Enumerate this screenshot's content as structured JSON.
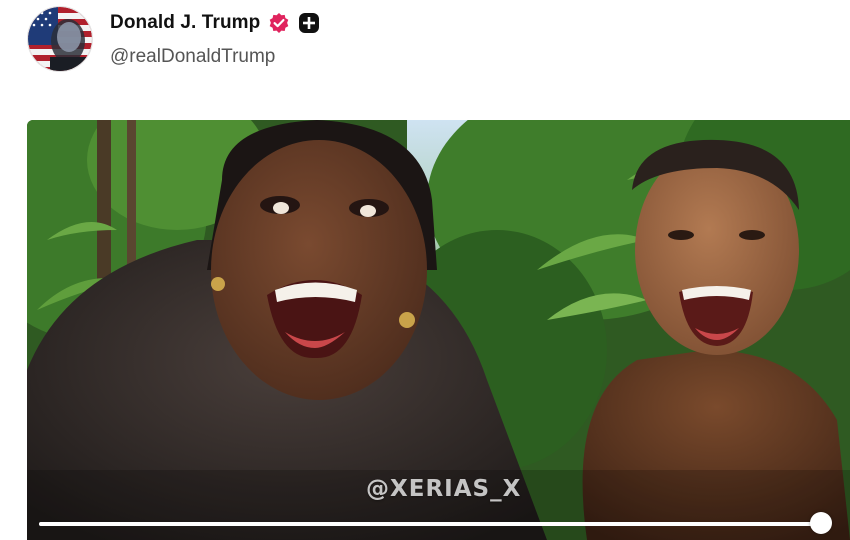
{
  "post": {
    "author": {
      "display_name": "Donald J. Trump",
      "handle": "@realDonaldTrump",
      "verified_icon": "verified-badge-icon",
      "follow_icon": "plus-icon"
    },
    "media": {
      "type": "video",
      "watermark": "@XERIAS_X",
      "progress": 0.99
    }
  },
  "colors": {
    "verified": "#e0245e",
    "text_primary": "#111111",
    "text_secondary": "#555555"
  }
}
